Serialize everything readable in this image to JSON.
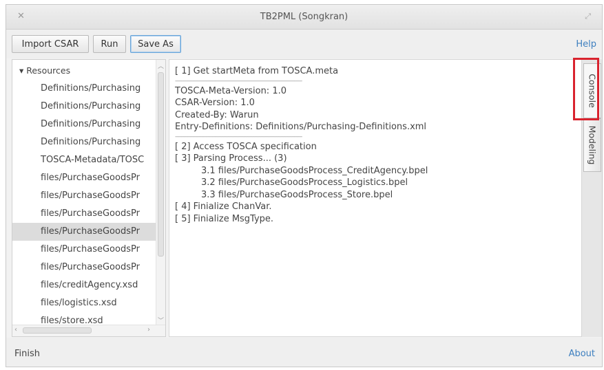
{
  "window": {
    "title": "TB2PML (Songkran)"
  },
  "toolbar": {
    "import_label": "Import CSAR",
    "run_label": "Run",
    "save_as_label": "Save As",
    "help_label": "Help"
  },
  "tree": {
    "root_label": "▾ Resources",
    "items": [
      "Definitions/Purchasing",
      "Definitions/Purchasing",
      "Definitions/Purchasing",
      "Definitions/Purchasing",
      "TOSCA-Metadata/TOSC",
      "files/PurchaseGoodsPr",
      "files/PurchaseGoodsPr",
      "files/PurchaseGoodsPr",
      "files/PurchaseGoodsPr",
      "files/PurchaseGoodsPr",
      "files/PurchaseGoodsPr",
      "files/creditAgency.xsd",
      "files/logistics.xsd",
      "files/store.xsd"
    ],
    "selected_index": 8
  },
  "console": {
    "lines": [
      "[ 1] Get startMeta from TOSCA.meta",
      "----------------------------------------------------------------------------------",
      "TOSCA-Meta-Version: 1.0",
      "CSAR-Version: 1.0",
      "Created-By: Warun",
      "Entry-Definitions: Definitions/Purchasing-Definitions.xml",
      "----------------------------------------------------------------------------------",
      "[ 2] Access TOSCA specification",
      "[ 3] Parsing Process... (3)",
      "3.1 files/PurchaseGoodsProcess_CreditAgency.bpel",
      "3.2 files/PurchaseGoodsProcess_Logistics.bpel",
      "3.3 files/PurchaseGoodsProcess_Store.bpel",
      "[ 4] Finialize ChanVar.",
      "[ 5] Finialize MsgType."
    ]
  },
  "tabs": {
    "console_label": "Console",
    "modeling_label": "Modeling",
    "active": "Console"
  },
  "status": {
    "text": "Finish",
    "about_label": "About"
  },
  "colors": {
    "highlight": "#d9232e",
    "link": "#3d7fbf"
  }
}
